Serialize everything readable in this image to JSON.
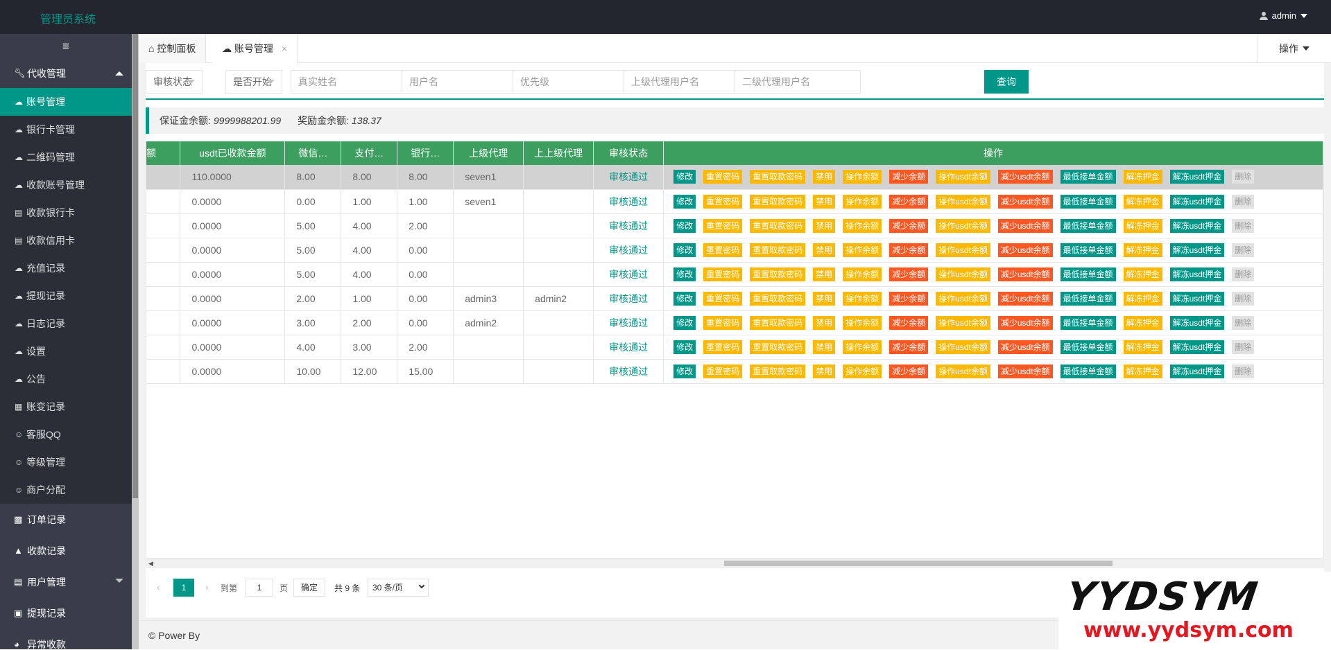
{
  "app": {
    "brand": "管理员系统",
    "user": "admin"
  },
  "sidebar": {
    "toggle": "≡",
    "group1": {
      "label": "代收管理"
    },
    "items": [
      {
        "label": "账号管理",
        "icon": "cloud-icon",
        "active": true
      },
      {
        "label": "银行卡管理",
        "icon": "cloud-icon"
      },
      {
        "label": "二维码管理",
        "icon": "cloud-icon"
      },
      {
        "label": "收款账号管理",
        "icon": "cloud-icon"
      },
      {
        "label": "收款银行卡",
        "icon": "book-icon"
      },
      {
        "label": "收款信用卡",
        "icon": "book-icon"
      },
      {
        "label": "充值记录",
        "icon": "cloud-icon"
      },
      {
        "label": "提现记录",
        "icon": "cloud-icon"
      },
      {
        "label": "日志记录",
        "icon": "cloud-icon"
      },
      {
        "label": "设置",
        "icon": "cloud-icon"
      },
      {
        "label": "公告",
        "icon": "cloud-icon"
      },
      {
        "label": "账变记录",
        "icon": "calculator-icon"
      },
      {
        "label": "客服QQ",
        "icon": "user-icon"
      },
      {
        "label": "等级管理",
        "icon": "user-icon"
      },
      {
        "label": "商户分配",
        "icon": "user-icon"
      }
    ],
    "groups": [
      {
        "label": "订单记录",
        "icon": "bar-chart-icon"
      },
      {
        "label": "收款记录",
        "icon": "area-chart-icon"
      },
      {
        "label": "用户管理",
        "icon": "user-card-icon"
      },
      {
        "label": "提现记录",
        "icon": "money-icon"
      },
      {
        "label": "异常收款",
        "icon": "pie-chart-icon"
      }
    ]
  },
  "tabs": {
    "home": "控制面板",
    "current": "账号管理",
    "close": "×",
    "ops": "操作"
  },
  "search": {
    "audit_status": "审核状态",
    "is_started": "是否开始",
    "real_name": "真实姓名",
    "username": "用户名",
    "priority": "优先级",
    "parent_agent": "上级代理用户名",
    "second_agent": "二级代理用户名",
    "query": "查询"
  },
  "balance": {
    "deposit_label": "保证金余额:",
    "deposit_value": "9999988201.99",
    "reward_label": "奖励金余额:",
    "reward_value": "138.37"
  },
  "table": {
    "headers": [
      "额",
      "usdt已收款金额",
      "微信…",
      "支付…",
      "银行…",
      "上级代理",
      "上上级代理",
      "审核状态",
      "操作"
    ],
    "rows": [
      {
        "usdt": "110.0000",
        "wx": "8.00",
        "zfb": "8.00",
        "bank": "8.00",
        "parent": "seven1",
        "gparent": "",
        "status": "审核通过"
      },
      {
        "usdt": "0.0000",
        "wx": "0.00",
        "zfb": "1.00",
        "bank": "1.00",
        "parent": "seven1",
        "gparent": "",
        "status": "审核通过"
      },
      {
        "usdt": "0.0000",
        "wx": "5.00",
        "zfb": "4.00",
        "bank": "2.00",
        "parent": "",
        "gparent": "",
        "status": "审核通过"
      },
      {
        "usdt": "0.0000",
        "wx": "5.00",
        "zfb": "4.00",
        "bank": "0.00",
        "parent": "",
        "gparent": "",
        "status": "审核通过"
      },
      {
        "usdt": "0.0000",
        "wx": "5.00",
        "zfb": "4.00",
        "bank": "0.00",
        "parent": "",
        "gparent": "",
        "status": "审核通过"
      },
      {
        "usdt": "0.0000",
        "wx": "2.00",
        "zfb": "1.00",
        "bank": "0.00",
        "parent": "admin3",
        "gparent": "admin2",
        "status": "审核通过"
      },
      {
        "usdt": "0.0000",
        "wx": "3.00",
        "zfb": "2.00",
        "bank": "0.00",
        "parent": "admin2",
        "gparent": "",
        "status": "审核通过"
      },
      {
        "usdt": "0.0000",
        "wx": "4.00",
        "zfb": "3.00",
        "bank": "2.00",
        "parent": "",
        "gparent": "",
        "status": "审核通过"
      },
      {
        "usdt": "0.0000",
        "wx": "10.00",
        "zfb": "12.00",
        "bank": "15.00",
        "parent": "",
        "gparent": "",
        "status": "审核通过"
      }
    ],
    "actions": [
      {
        "label": "修改",
        "color": "#009688"
      },
      {
        "label": "重置密码",
        "color": "#ffb800"
      },
      {
        "label": "重置取款密码",
        "color": "#ffb800"
      },
      {
        "label": "禁用",
        "color": "#ffb800"
      },
      {
        "label": "操作余额",
        "color": "#ffb800"
      },
      {
        "label": "减少余额",
        "color": "#ff5722"
      },
      {
        "label": "操作usdt余额",
        "color": "#ffb800"
      },
      {
        "label": "减少usdt余额",
        "color": "#ff5722"
      },
      {
        "label": "最低接单金额",
        "color": "#009688"
      },
      {
        "label": "解冻押金",
        "color": "#ffb800"
      },
      {
        "label": "解冻usdt押金",
        "color": "#009688"
      },
      {
        "label": "删除",
        "color": "#e2e2e2"
      }
    ]
  },
  "pager": {
    "current": "1",
    "goto": "到第",
    "page_input": "1",
    "page_unit": "页",
    "confirm": "确定",
    "total": "共 9 条",
    "size": "30 条/页"
  },
  "footer": {
    "text": "© Power By"
  },
  "watermark": {
    "line1": "YYDSYM",
    "line2": "www.yydsym.com"
  }
}
